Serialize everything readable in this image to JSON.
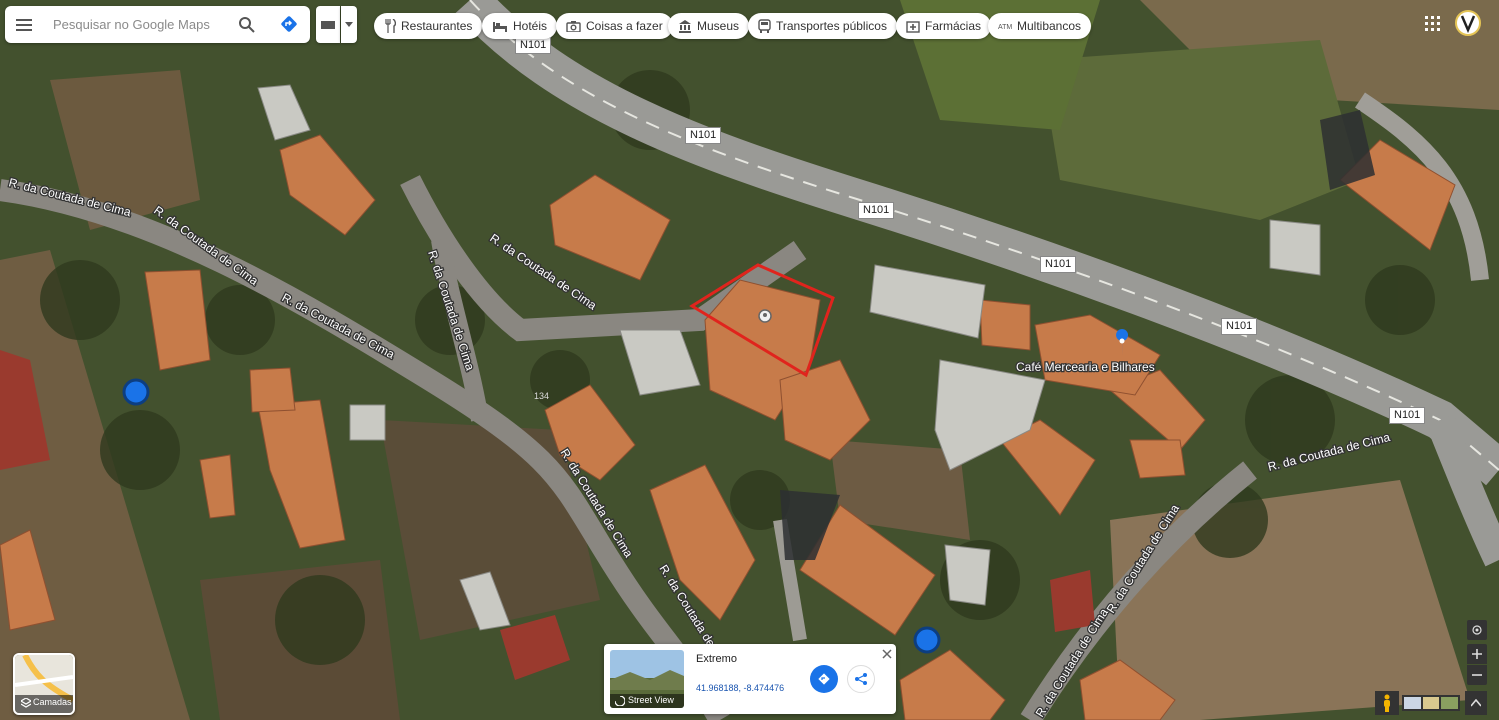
{
  "search": {
    "placeholder": "Pesquisar no Google Maps"
  },
  "chips": [
    {
      "label": "Restaurantes",
      "icon": "fork-knife-icon"
    },
    {
      "label": "Hotéis",
      "icon": "bed-icon"
    },
    {
      "label": "Coisas a fazer",
      "icon": "camera-icon"
    },
    {
      "label": "Museus",
      "icon": "museum-icon"
    },
    {
      "label": "Transportes públicos",
      "icon": "bus-icon"
    },
    {
      "label": "Farmácias",
      "icon": "pharmacy-icon"
    },
    {
      "label": "Multibancos",
      "icon": "atm-icon"
    }
  ],
  "map": {
    "road_shield": "N101",
    "street_name": "R. da Coutada de Cima",
    "poi_label": "Café Mercearia e Bilhares",
    "house_number": "134"
  },
  "place_card": {
    "title": "Extremo",
    "coordinates": "41.968188, -8.474476",
    "thumbnail_label": "Street View"
  },
  "layers": {
    "label": "Camadas"
  },
  "colors": {
    "selection_outline": "#e0241d",
    "accent_blue": "#1a73e8"
  }
}
